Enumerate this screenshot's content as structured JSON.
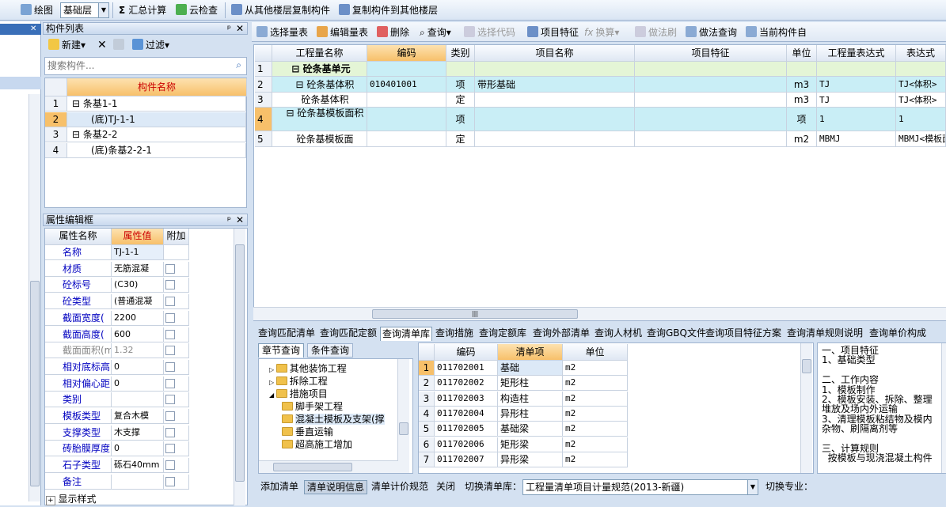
{
  "toolbar": {
    "draw": "绘图",
    "layer": "基础层",
    "sum": "汇总计算",
    "cloud": "云检查",
    "copy_from": "从其他楼层复制构件",
    "copy_to": "复制构件到其他楼层"
  },
  "comp_list": {
    "title": "构件列表",
    "new": "新建",
    "filter": "过滤",
    "search_placeholder": "搜索构件...",
    "col_name": "构件名称",
    "rows": [
      {
        "no": "1",
        "name": "条基1-1"
      },
      {
        "no": "2",
        "name": "(底)TJ-1-1"
      },
      {
        "no": "3",
        "name": "条基2-2"
      },
      {
        "no": "4",
        "name": "(底)条基2-2-1"
      }
    ]
  },
  "props": {
    "title": "属性编辑框",
    "col_name": "属性名称",
    "col_value": "属性值",
    "col_extra": "附加",
    "rows": [
      {
        "name": "名称",
        "value": "TJ-1-1"
      },
      {
        "name": "材质",
        "value": "无筋混凝"
      },
      {
        "name": "砼标号",
        "value": "(C30)"
      },
      {
        "name": "砼类型",
        "value": "(普通混凝"
      },
      {
        "name": "截面宽度(",
        "value": "2200"
      },
      {
        "name": "截面高度(",
        "value": "600"
      },
      {
        "name": "截面面积(m",
        "value": "1.32"
      },
      {
        "name": "相对底标高",
        "value": "0"
      },
      {
        "name": "相对偏心距",
        "value": "0"
      },
      {
        "name": "类别",
        "value": ""
      },
      {
        "name": "模板类型",
        "value": "复合木模"
      },
      {
        "name": "支撑类型",
        "value": "木支撑"
      },
      {
        "name": "砖胎膜厚度",
        "value": "0"
      },
      {
        "name": "石子类型",
        "value": "砾石40mm"
      },
      {
        "name": "备注",
        "value": ""
      }
    ],
    "more": "显示样式"
  },
  "grid_toolbar": {
    "select_table": "选择量表",
    "edit_table": "编辑量表",
    "delete": "删除",
    "query": "查询",
    "select_code": "选择代码",
    "feature": "项目特征",
    "convert": "换算",
    "method_brush": "做法刷",
    "method_query": "做法查询",
    "current": "当前构件自"
  },
  "grid": {
    "headers": [
      "工程量名称",
      "编码",
      "类别",
      "项目名称",
      "项目特征",
      "单位",
      "工程量表达式",
      "表达式"
    ],
    "rows": [
      {
        "no": "1",
        "name": "砼条基单元",
        "code": "",
        "type": "",
        "pname": "",
        "feat": "",
        "unit": "",
        "expr": "",
        "expr2": ""
      },
      {
        "no": "2",
        "name": "砼条基体积",
        "code": "010401001",
        "type": "项",
        "pname": "带形基础",
        "feat": "",
        "unit": "m3",
        "expr": "TJ",
        "expr2": "TJ<体积>"
      },
      {
        "no": "3",
        "name": "砼条基体积",
        "code": "",
        "type": "定",
        "pname": "",
        "feat": "",
        "unit": "m3",
        "expr": "TJ",
        "expr2": "TJ<体积>"
      },
      {
        "no": "4",
        "name": "砼条基模板面积",
        "code": "",
        "type": "项",
        "pname": "",
        "feat": "",
        "unit": "项",
        "expr": "1",
        "expr2": "1"
      },
      {
        "no": "5",
        "name": "砼条基模板面",
        "code": "",
        "type": "定",
        "pname": "",
        "feat": "",
        "unit": "m2",
        "expr": "MBMJ",
        "expr2": "MBMJ<模板面"
      }
    ]
  },
  "bottom_tabs": [
    "查询匹配清单",
    "查询匹配定额",
    "查询清单库",
    "查询措施",
    "查询定额库",
    "查询外部清单",
    "查询人材机",
    "查询GBQ文件",
    "查询项目特征方案",
    "查询清单规则说明",
    "查询单价构成"
  ],
  "subtabs": [
    "章节查询",
    "条件查询"
  ],
  "tree": [
    "其他装饰工程",
    "拆除工程",
    "措施项目",
    "脚手架工程",
    "混凝土模板及支架(撑",
    "垂直运输",
    "超高施工增加"
  ],
  "list": {
    "headers": [
      "编码",
      "清单项",
      "单位"
    ],
    "rows": [
      {
        "no": "1",
        "code": "011702001",
        "name": "基础",
        "unit": "m2"
      },
      {
        "no": "2",
        "code": "011702002",
        "name": "矩形柱",
        "unit": "m2"
      },
      {
        "no": "3",
        "code": "011702003",
        "name": "构造柱",
        "unit": "m2"
      },
      {
        "no": "4",
        "code": "011702004",
        "name": "异形柱",
        "unit": "m2"
      },
      {
        "no": "5",
        "code": "011702005",
        "name": "基础梁",
        "unit": "m2"
      },
      {
        "no": "6",
        "code": "011702006",
        "name": "矩形梁",
        "unit": "m2"
      },
      {
        "no": "7",
        "code": "011702007",
        "name": "异形梁",
        "unit": "m2"
      }
    ]
  },
  "desc": [
    "一、项目特征",
    "1、基础类型",
    "",
    "二、工作内容",
    "1、模板制作",
    "2、模板安装、拆除、整理",
    "堆放及场内外运输",
    "3、清理模板粘结物及模内",
    "杂物、刷隔离剂等",
    "",
    "三、计算规则",
    "  按模板与现浇混凝土构件"
  ],
  "bottom_bar": {
    "add": "添加清单",
    "desc_info": "清单说明信息",
    "price_rule": "清单计价规范",
    "close": "关闭",
    "switch_lib": "切换清单库：",
    "lib": "工程量清单项目计量规范(2013-新疆)",
    "switch_major": "切换专业："
  }
}
